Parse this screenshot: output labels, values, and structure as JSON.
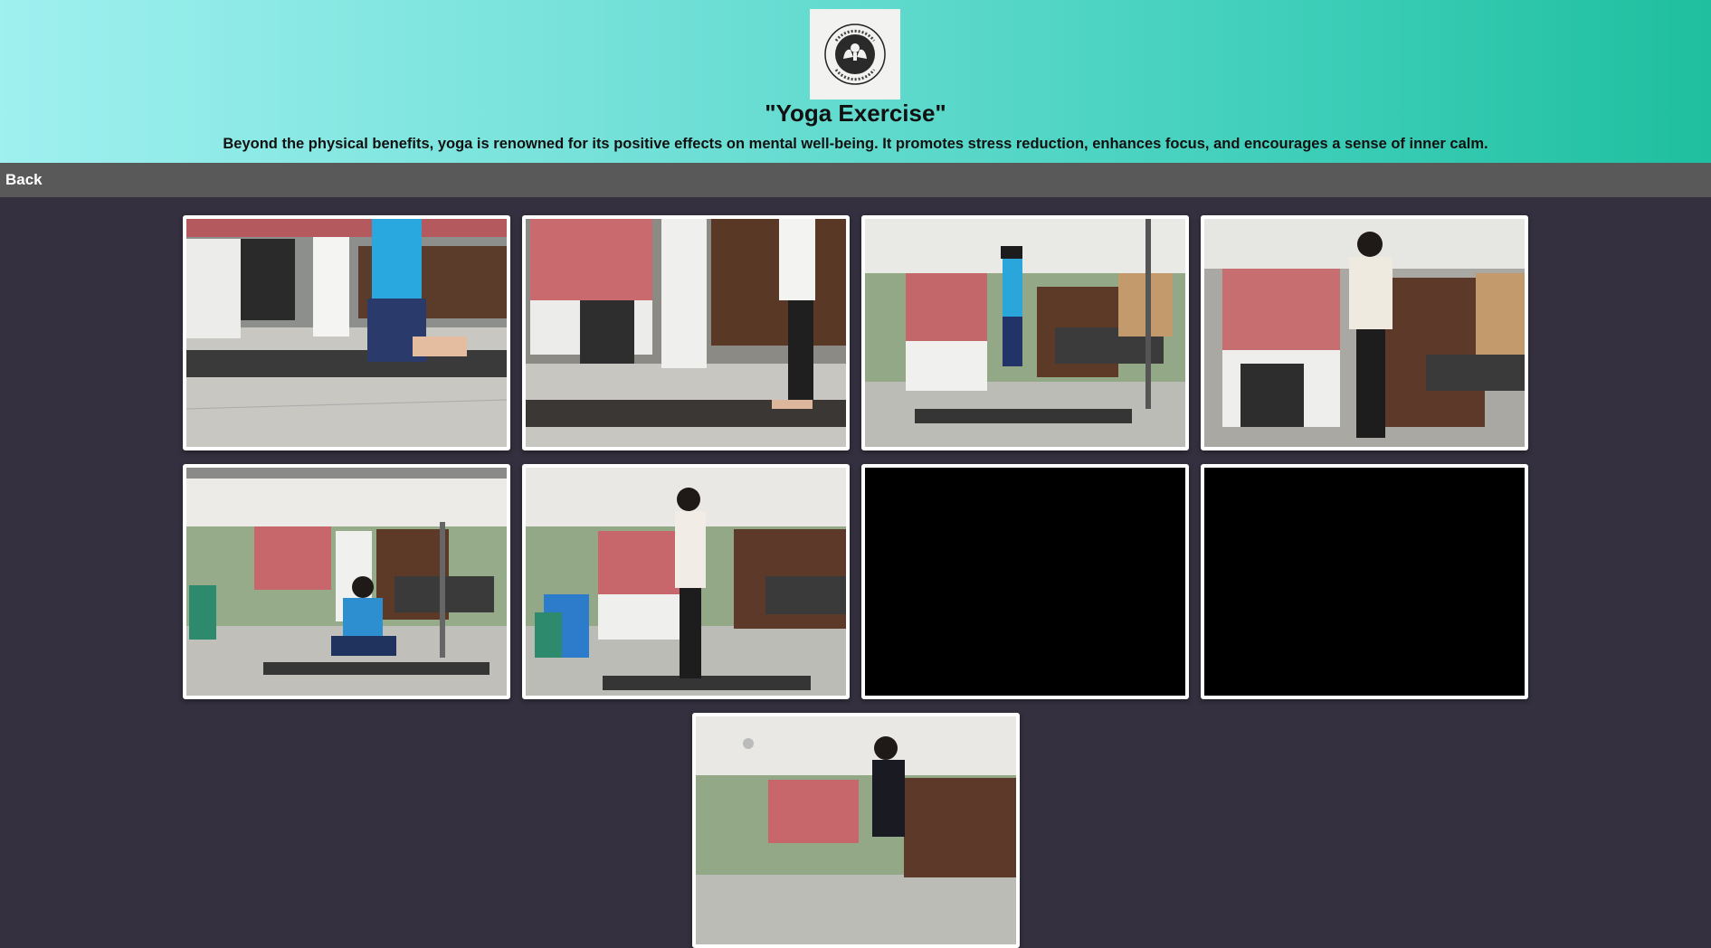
{
  "header": {
    "logo_icon": "we-care-hands-logo-icon",
    "logo_text_top": "WE CARE",
    "logo_text_right": "MENTAL",
    "logo_text_bottom": "DIGITAL MINDFULNESS",
    "title": "\"Yoga Exercise\"",
    "description": "Beyond the physical benefits, yoga is renowned for its positive effects on mental well-being. It promotes stress reduction, enhances focus, and encourages a sense of inner calm."
  },
  "nav": {
    "back_label": "Back"
  },
  "videos": [
    {
      "id": 1,
      "scene": "kneeling-pose",
      "state": "thumbnail"
    },
    {
      "id": 2,
      "scene": "standing-pose-side",
      "state": "thumbnail"
    },
    {
      "id": 3,
      "scene": "standing-pose-wide",
      "state": "thumbnail"
    },
    {
      "id": 4,
      "scene": "standing-pose-front",
      "state": "thumbnail"
    },
    {
      "id": 5,
      "scene": "seated-cross-legged",
      "state": "thumbnail"
    },
    {
      "id": 6,
      "scene": "standing-look-up",
      "state": "thumbnail"
    },
    {
      "id": 7,
      "scene": "blank",
      "state": "black"
    },
    {
      "id": 8,
      "scene": "blank",
      "state": "black"
    },
    {
      "id": 9,
      "scene": "standing-pose-partial",
      "state": "thumbnail"
    }
  ],
  "colors": {
    "header_gradient_start": "#9ff0ef",
    "header_gradient_end": "#1fbf9f",
    "navbar": "#595959",
    "page_background": "#34303f",
    "tile_border": "#ffffff"
  }
}
